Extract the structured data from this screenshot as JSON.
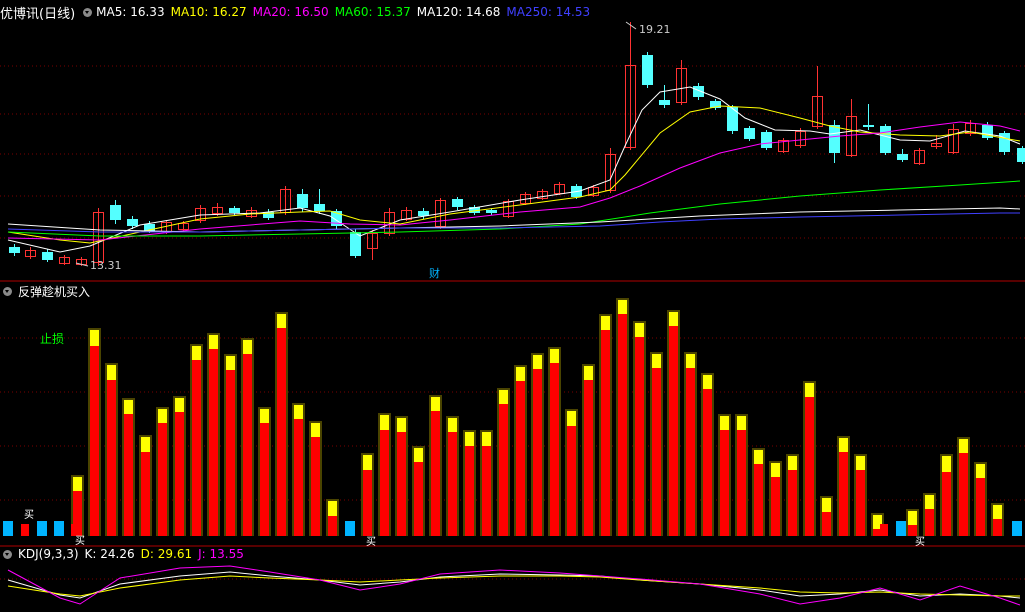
{
  "main_panel": {
    "stock_name": "优博讯",
    "period": "(日线)",
    "ma_items": [
      {
        "label": "MA5: 16.33",
        "color": "#ffffff"
      },
      {
        "label": "MA10: 16.27",
        "color": "#ffff00"
      },
      {
        "label": "MA20: 16.50",
        "color": "#ff00ff"
      },
      {
        "label": "MA60: 15.37",
        "color": "#00ff00"
      },
      {
        "label": "MA120: 14.68",
        "color": "#ffffff"
      },
      {
        "label": "MA250: 14.53",
        "color": "#4040ff"
      }
    ],
    "high_annotation": "19.21",
    "low_annotation": "13.31",
    "finance_marker": "财"
  },
  "indicator_panel": {
    "title": "反弹趁机买入",
    "stop_loss_label": "止损",
    "buy_label": "买"
  },
  "kdj_panel": {
    "name": "KDJ(9,3,3)",
    "k_label": "K: 24.26",
    "d_label": "D: 29.61",
    "j_label": "J: 13.55"
  },
  "colors": {
    "up_candle": "#ff3232",
    "down_candle": "#54ffff",
    "divider": "#b00000",
    "grid": "#7a0000",
    "bar_red": "#ff0000",
    "bar_yellow": "#ffff00",
    "bar_dark": "#4a4400",
    "bar_cyan": "#00b4ff",
    "k_line": "#ffffff",
    "d_line": "#ffff00",
    "j_line": "#ff00ff"
  }
}
